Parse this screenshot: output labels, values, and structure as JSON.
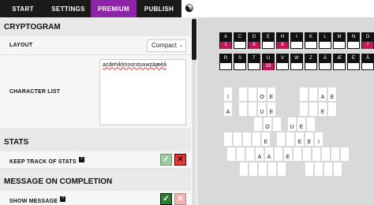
{
  "tabs": [
    {
      "label": "START"
    },
    {
      "label": "SETTINGS"
    },
    {
      "label": "PREMIUM"
    },
    {
      "label": "PUBLISH"
    }
  ],
  "theme_icon": "yin-yang-icon",
  "sections": {
    "cryptogram": {
      "title": "CRYPTOGRAM",
      "layout_label": "LAYOUT",
      "layout_value": "Compact",
      "charlist_label": "CHARACTER LIST",
      "charlist_value": "acdehiklmnorstuvwzäæéå"
    },
    "stats": {
      "title": "STATS",
      "keep_label": "KEEP TRACK OF STATS",
      "help": "?"
    },
    "completion": {
      "title": "MESSAGE ON COMPLETION",
      "show_label": "SHOW MESSAGE",
      "help": "?"
    }
  },
  "toggles": {
    "check": "✓",
    "cross": "✕"
  },
  "key_row_1": [
    {
      "l": "A",
      "n": "1",
      "hl": true
    },
    {
      "l": "C",
      "n": "",
      "hl": false
    },
    {
      "l": "D",
      "n": "6",
      "hl": true
    },
    {
      "l": "E",
      "n": "",
      "hl": false
    },
    {
      "l": "H",
      "n": "8",
      "hl": true
    },
    {
      "l": "I",
      "n": "",
      "hl": false
    },
    {
      "l": "K",
      "n": "",
      "hl": false
    },
    {
      "l": "L",
      "n": "",
      "hl": false
    },
    {
      "l": "M",
      "n": "",
      "hl": false
    },
    {
      "l": "N",
      "n": "",
      "hl": false
    },
    {
      "l": "O",
      "n": "7",
      "hl": true
    }
  ],
  "key_row_2": [
    {
      "l": "R",
      "n": "",
      "hl": false
    },
    {
      "l": "S",
      "n": "",
      "hl": false
    },
    {
      "l": "T",
      "n": "",
      "hl": false
    },
    {
      "l": "U",
      "n": "19",
      "hl": true
    },
    {
      "l": "V",
      "n": "",
      "hl": false
    },
    {
      "l": "W",
      "n": "",
      "hl": false
    },
    {
      "l": "Z",
      "n": "",
      "hl": false
    },
    {
      "l": "Ä",
      "n": "",
      "hl": false
    },
    {
      "l": "Æ",
      "n": "",
      "hl": false
    },
    {
      "l": "É",
      "n": "",
      "hl": false
    },
    {
      "l": "Å",
      "n": "",
      "hl": false
    }
  ]
}
